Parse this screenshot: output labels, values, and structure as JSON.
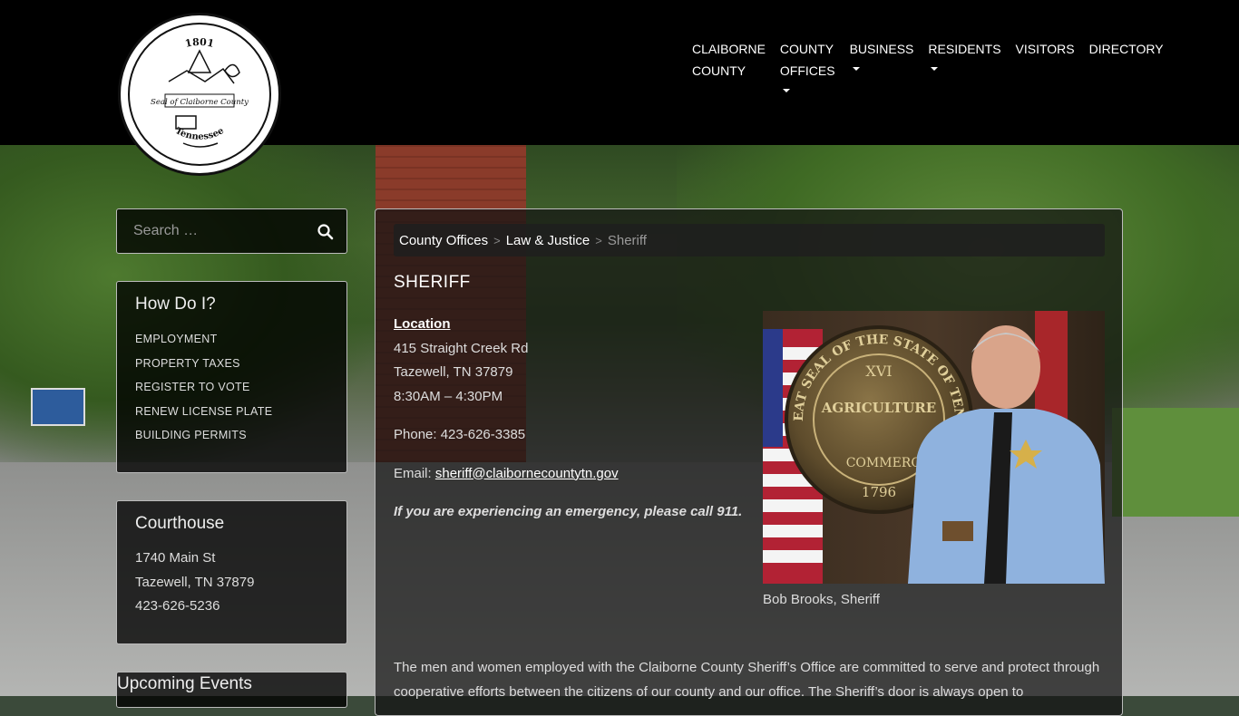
{
  "header": {
    "logo_text_top": "1801",
    "logo_text_middle": "Seal of Claiborne County",
    "logo_text_bottom": "Tennessee",
    "nav": [
      {
        "label": "CLAIBORNE\nCOUNTY",
        "dropdown": false
      },
      {
        "label": "COUNTY\nOFFICES",
        "dropdown": true
      },
      {
        "label": "BUSINESS",
        "dropdown": true
      },
      {
        "label": "RESIDENTS",
        "dropdown": true
      },
      {
        "label": "VISITORS",
        "dropdown": false
      },
      {
        "label": "DIRECTORY",
        "dropdown": false
      }
    ]
  },
  "sidebar": {
    "search": {
      "placeholder": "Search …"
    },
    "how_do_i": {
      "title": "How Do I?",
      "items": [
        "EMPLOYMENT",
        "PROPERTY TAXES",
        "REGISTER TO VOTE",
        "RENEW LICENSE PLATE",
        "BUILDING PERMITS"
      ]
    },
    "courthouse": {
      "title": "Courthouse",
      "address1": "1740 Main St",
      "address2": "Tazewell, TN 37879",
      "phone": "423-626-5236"
    },
    "events": {
      "title": "Upcoming Events"
    }
  },
  "main": {
    "breadcrumb": {
      "level1": "County Offices",
      "level2": "Law & Justice",
      "current": "Sheriff",
      "separator": ">"
    },
    "title": "SHERIFF",
    "location_label": "Location",
    "address1": "415 Straight Creek Rd",
    "address2": "Tazewell, TN 37879",
    "hours": "8:30AM – 4:30PM",
    "phone": "Phone: 423-626-3385",
    "email_label": "Email:",
    "email": "sheriff@claibornecountytn.gov",
    "emergency": "If you are experiencing an emergency, please call 911.",
    "photo_caption": "Bob Brooks, Sheriff",
    "photo_seal_text": "THE GREAT SEAL OF THE STATE OF TENNESSEE",
    "seal_center_top": "XVI",
    "seal_center_mid": "AGRICULTURE",
    "seal_center_low": "COMMERCE",
    "seal_year": "1796",
    "body_text": "The men and women employed with the Claiborne County Sheriff’s Office are committed to serve and protect through cooperative efforts between the citizens of our county and our office. The Sheriff’s door is always open to"
  }
}
